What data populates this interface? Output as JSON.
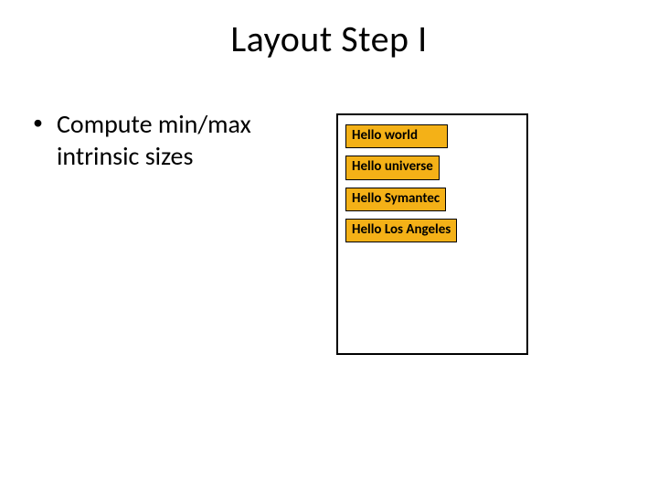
{
  "title": "Layout Step I",
  "bullet": {
    "dot": "•",
    "text": "Compute min/max intrinsic sizes"
  },
  "boxes": {
    "b1": "Hello world",
    "b2": "Hello universe",
    "b3": "Hello Symantec",
    "b4": "Hello Los Angeles"
  },
  "colors": {
    "boxFill": "#f4b117"
  }
}
